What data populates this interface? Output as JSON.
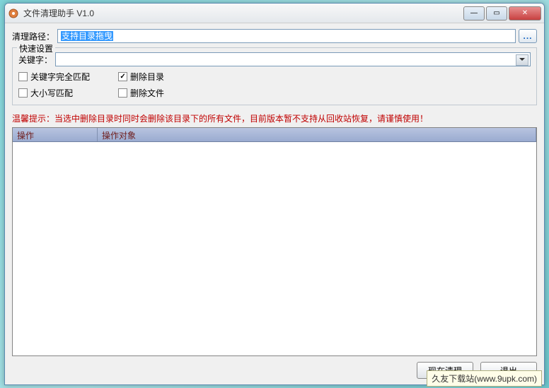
{
  "title": "文件清理助手 V1.0",
  "path": {
    "label": "清理路径：",
    "value": "支持目录拖曳",
    "browse_label": "..."
  },
  "group": {
    "title": "快速设置",
    "keyword_label": "关键字：",
    "keyword_value": "",
    "checks": {
      "full_match": {
        "label": "关键字完全匹配",
        "checked": false
      },
      "case_match": {
        "label": "大小写匹配",
        "checked": false
      },
      "del_dir": {
        "label": "删除目录",
        "checked": true
      },
      "del_file": {
        "label": "删除文件",
        "checked": false
      }
    }
  },
  "warning": {
    "label": "温馨提示：",
    "text": "当选中删除目录时同时会删除该目录下的所有文件，目前版本暂不支持从回收站恢复，请谨慎使用！"
  },
  "list": {
    "col1": "操作",
    "col2": "操作对象"
  },
  "buttons": {
    "clean": "现在清理",
    "exit": "退出"
  },
  "watermark": "久友下载站(www.9upk.com)",
  "win": {
    "min": "—",
    "max": "▭",
    "close": "✕"
  }
}
